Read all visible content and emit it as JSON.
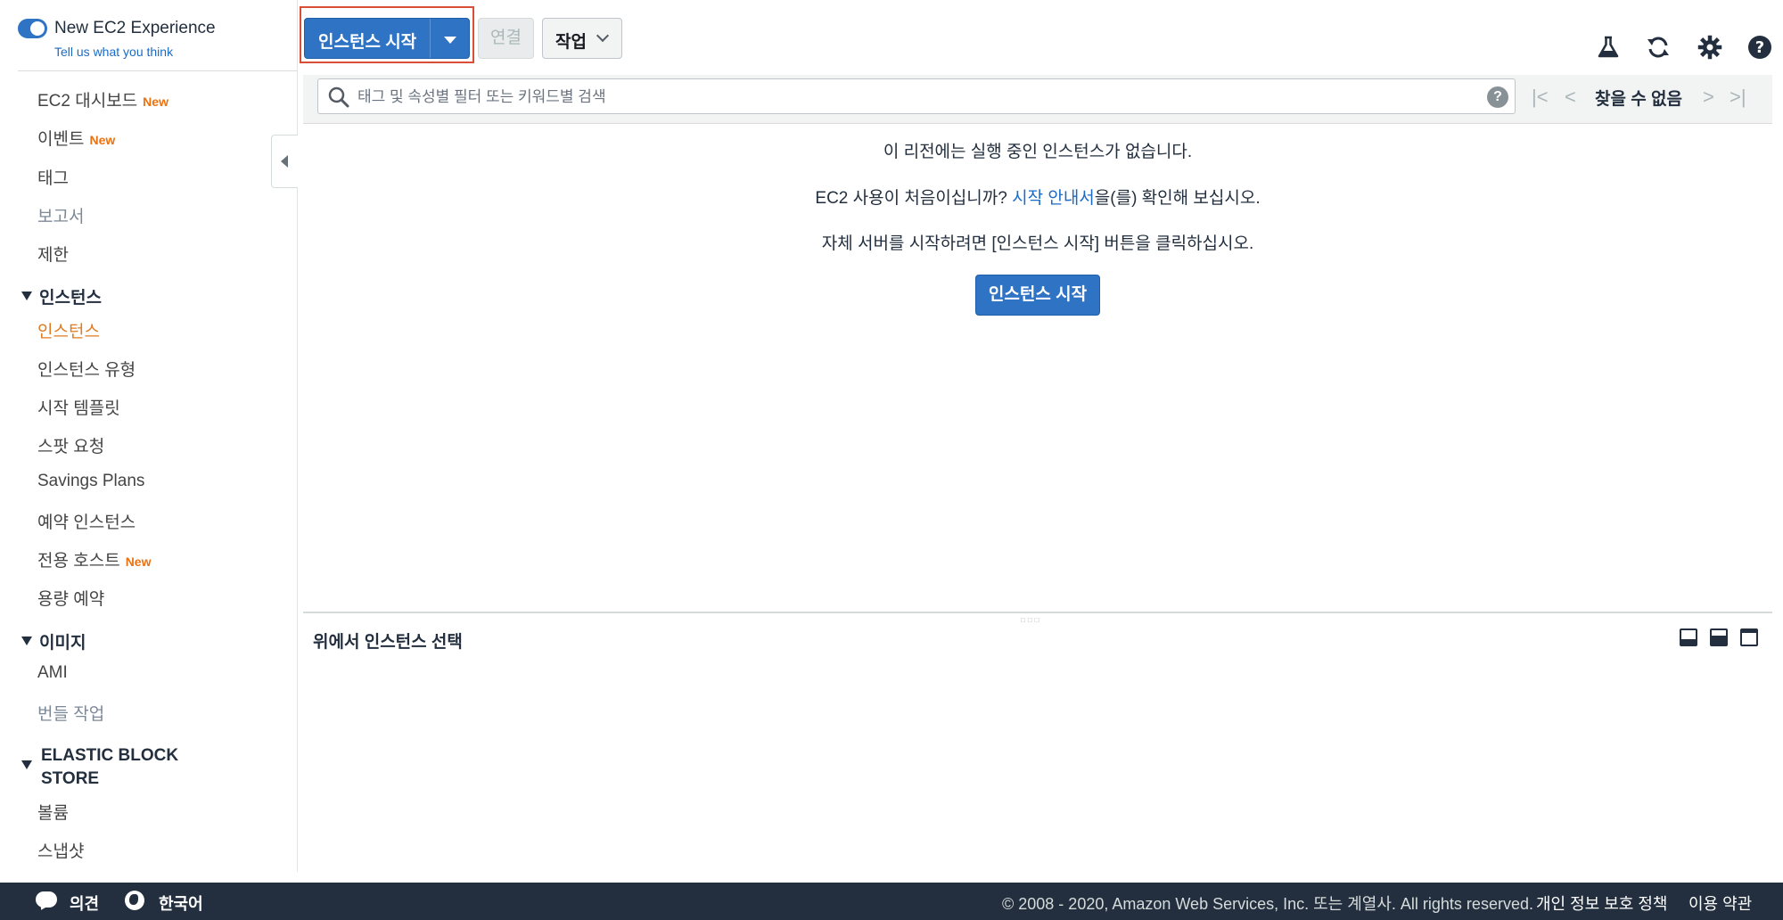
{
  "new_experience": {
    "title": "New EC2 Experience",
    "feedback_link": "Tell us what you think"
  },
  "sidebar": {
    "top_items": [
      {
        "label": "EC2 대시보드",
        "badge": "New"
      },
      {
        "label": "이벤트",
        "badge": "New"
      },
      {
        "label": "태그"
      },
      {
        "label": "보고서"
      },
      {
        "label": "제한"
      }
    ],
    "instances_section": {
      "title": "인스턴스",
      "items": [
        {
          "label": "인스턴스"
        },
        {
          "label": "인스턴스 유형"
        },
        {
          "label": "시작 템플릿"
        },
        {
          "label": "스팟 요청"
        },
        {
          "label": "Savings Plans"
        },
        {
          "label": "예약 인스턴스"
        },
        {
          "label": "전용 호스트",
          "badge": "New"
        },
        {
          "label": "용량 예약"
        }
      ]
    },
    "images_section": {
      "title": "이미지",
      "items": [
        {
          "label": "AMI"
        },
        {
          "label": "번들 작업"
        }
      ]
    },
    "ebs_section": {
      "title_line1": "ELASTIC BLOCK",
      "title_line2": "STORE",
      "items": [
        {
          "label": "볼륨"
        },
        {
          "label": "스냅샷"
        }
      ]
    }
  },
  "toolbar": {
    "launch_label": "인스턴스 시작",
    "connect_label": "연결",
    "actions_label": "작업"
  },
  "toolbar_icons": [
    "flask-icon",
    "refresh-icon",
    "settings-gear-icon",
    "help-icon"
  ],
  "search": {
    "placeholder": "태그 및 속성별 필터 또는 키워드별 검색",
    "value": ""
  },
  "pagination": {
    "status": "찾을 수 없음"
  },
  "empty_state": {
    "line1": "이 리전에는 실행 중인 인스턴스가 없습니다.",
    "line2_prefix": "EC2 사용이 처음이십니까? ",
    "line2_link": "시작 안내서",
    "line2_suffix": "을(를) 확인해 보십시오.",
    "line3": "자체 서버를 시작하려면 [인스턴스 시작] 버튼을 클릭하십시오.",
    "button": "인스턴스 시작"
  },
  "detail_panel": {
    "title": "위에서 인스턴스 선택"
  },
  "footer": {
    "feedback": "의견",
    "language": "한국어",
    "copyright": "© 2008 - 2020, Amazon Web Services, Inc. 또는 계열사. All rights reserved.",
    "privacy": "개인 정보 보호 정책",
    "terms": "이용 약관"
  },
  "colors": {
    "primary_blue": "#2f73c4",
    "active_orange": "#e07b21",
    "badge_orange": "#ec7211",
    "footer_bg": "#232f3e",
    "highlight_red": "#d94f35"
  }
}
